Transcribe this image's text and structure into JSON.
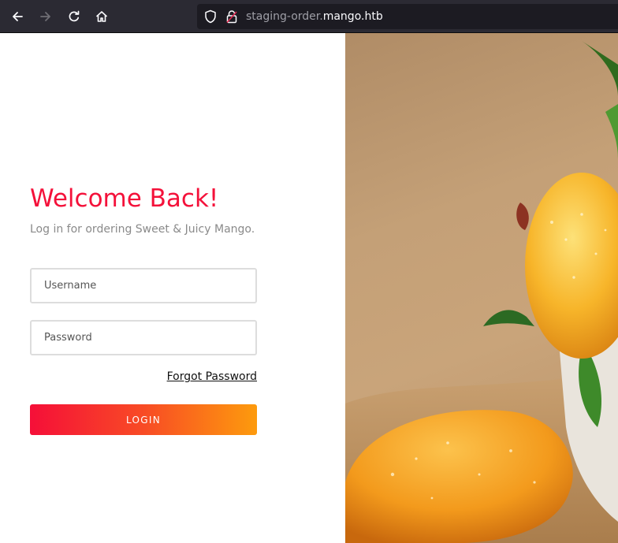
{
  "browser": {
    "url_subdomain": "staging-order.",
    "url_domain": "mango.htb",
    "icons": {
      "back": "arrow-left-icon",
      "forward": "arrow-right-icon",
      "reload": "reload-icon",
      "home": "home-icon",
      "tracking": "shield-icon",
      "security": "lock-icon"
    }
  },
  "login": {
    "title": "Welcome Back!",
    "subtitle": "Log in for ordering Sweet & Juicy Mango.",
    "username_placeholder": "Username",
    "username_value": "",
    "password_placeholder": "Password",
    "password_value": "",
    "forgot_label": "Forgot Password",
    "submit_label": "LOGIN"
  },
  "colors": {
    "accent": "#f4113a",
    "gradient_start": "#f50f38",
    "gradient_end": "#fd9b0d",
    "toolbar_bg": "#2b2a33"
  }
}
